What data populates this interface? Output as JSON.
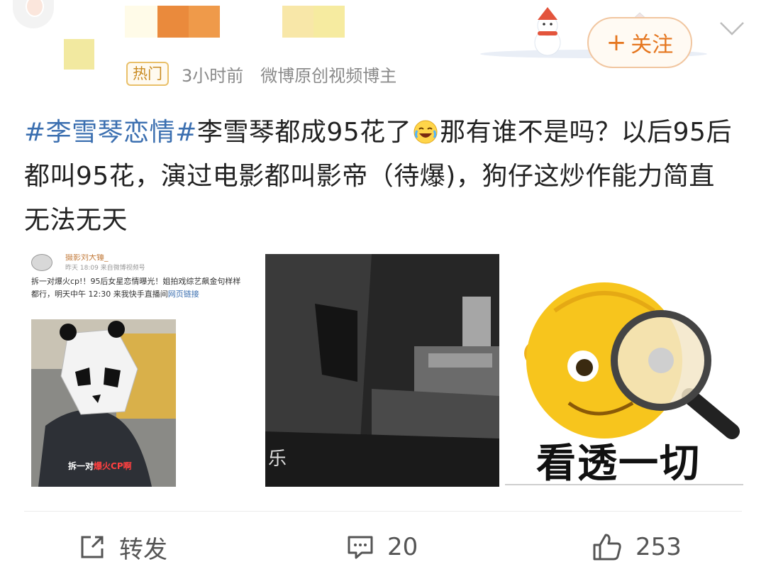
{
  "post": {
    "hot_badge": "热门",
    "time": "3小时前",
    "source": "微博原创视频博主",
    "follow_label": "关注",
    "hashtag": "#李雪琴恋情#",
    "text_part1": "李雪琴都成95花了",
    "text_part2": "那有谁不是吗？以后95后都叫95花，演过电影都叫影帝（待爆)，狗仔这炒作能力简直无法无天"
  },
  "images": {
    "img1": {
      "author": "摄影刘大锤_",
      "time": "昨天 18:09 来自微博视频号",
      "text": "拆一对爆火cp!！95后女星恋情曝光！姐拍戏综艺飙金句样样都行，明天中午 12:30 来我快手直播间",
      "link": "网页链接",
      "caption_a": "拆一对",
      "caption_b": "爆火CP啊"
    },
    "img2": {
      "label": "乐"
    },
    "img3": {
      "caption": "看透一切"
    }
  },
  "actions": {
    "repost_label": "转发",
    "comment_count": "20",
    "like_count": "253"
  },
  "colors": {
    "accent": "#e5761f",
    "tag": "#3b6fb0",
    "hot": "#c98b22"
  },
  "icons": [
    "repost-icon",
    "comment-icon",
    "like-icon",
    "chevron-down-icon",
    "laughing-emoji-icon"
  ]
}
